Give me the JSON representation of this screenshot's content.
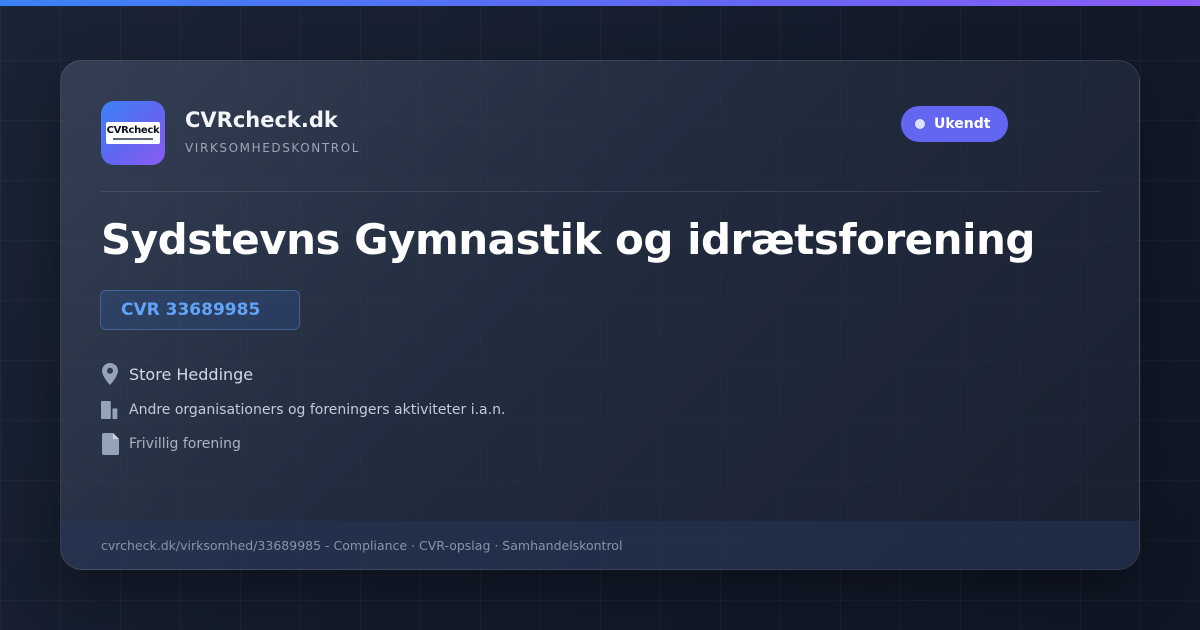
{
  "brand": {
    "logo_text": "CVRcheck",
    "name": "CVRcheck.dk",
    "tagline": "VIRKSOMHEDSKONTROL"
  },
  "status": {
    "label": "Ukendt",
    "color": "#6366f1"
  },
  "company": {
    "name": "Sydstevns Gymnastik og idrætsforening",
    "cvr": "CVR 33689985",
    "city": "Store Heddinge",
    "industry": "Andre organisationers og foreningers aktiviteter i.a.n.",
    "company_type": "Frivillig forening"
  },
  "icons": {
    "city": "map-pin-icon",
    "industry": "building-icon",
    "company_type": "document-icon"
  },
  "footer": {
    "text": "cvrcheck.dk/virksomhed/33689985 - Compliance · CVR-opslag · Samhandelskontrol"
  },
  "colors": {
    "accent": "#6366f1",
    "cvr_text": "#60a5fa",
    "top_bar_start": "#3b82f6",
    "top_bar_end": "#8b5cf6"
  }
}
